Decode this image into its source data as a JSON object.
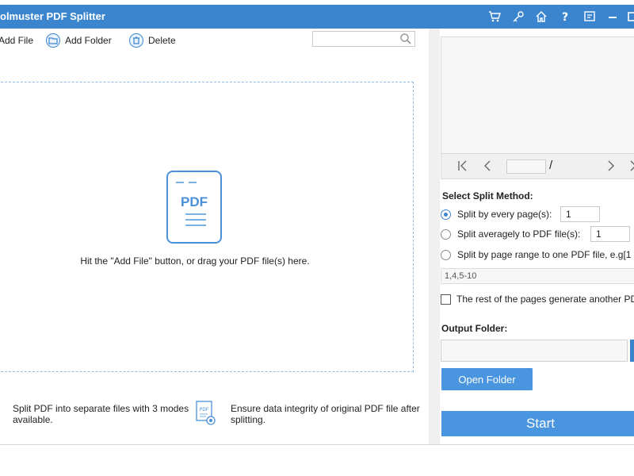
{
  "app": {
    "title": "olmuster PDF Splitter"
  },
  "titlebar_icons": [
    "cart-icon",
    "key-icon",
    "home-icon",
    "help-icon",
    "feedback-icon",
    "minimize-icon",
    "maximize-icon"
  ],
  "toolbar": {
    "add_file": "Add File",
    "add_folder": "Add Folder",
    "delete": "Delete",
    "search_placeholder": ""
  },
  "drop_area": {
    "icon_text": "PDF",
    "hint": "Hit the \"Add File\" button, or drag your PDF file(s) here."
  },
  "features": {
    "left": "Split PDF into separate files with 3 modes available.",
    "right": "Ensure data integrity of original PDF file after splitting."
  },
  "pager": {
    "slash": "/"
  },
  "split_method": {
    "label": "Select Split Method:",
    "options": [
      {
        "label": "Split by every page(s):",
        "value": "1",
        "selected": true
      },
      {
        "label": "Split averagely to PDF file(s):",
        "value": "1",
        "selected": false
      },
      {
        "label": "Split by page range to one PDF file, e.g[1",
        "selected": false
      }
    ],
    "range_value": "1,4,5-10",
    "rest_label": "The rest of the pages generate another PD"
  },
  "output": {
    "label": "Output Folder:",
    "value": "",
    "open_folder": "Open Folder"
  },
  "start": "Start",
  "colors": {
    "accent": "#3b85cf",
    "button": "#4a95df"
  }
}
